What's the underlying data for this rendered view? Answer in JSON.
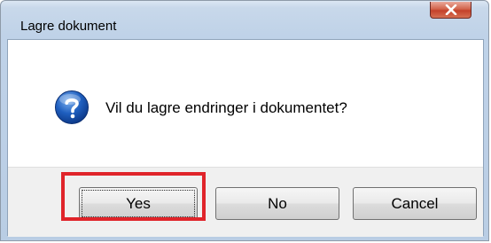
{
  "dialog": {
    "title": "Lagre dokument",
    "message": "Vil du lagre endringer i dokumentet?",
    "icon": "question-icon",
    "close_icon": "close-icon"
  },
  "buttons": {
    "yes": "Yes",
    "no": "No",
    "cancel": "Cancel"
  },
  "annotation": {
    "highlight_color": "#e0242a",
    "highlighted_button": "Yes"
  },
  "colors": {
    "close_button": "#c4412a",
    "icon_blue": "#1f5fbf",
    "title_bar": "#c8d8ea"
  }
}
